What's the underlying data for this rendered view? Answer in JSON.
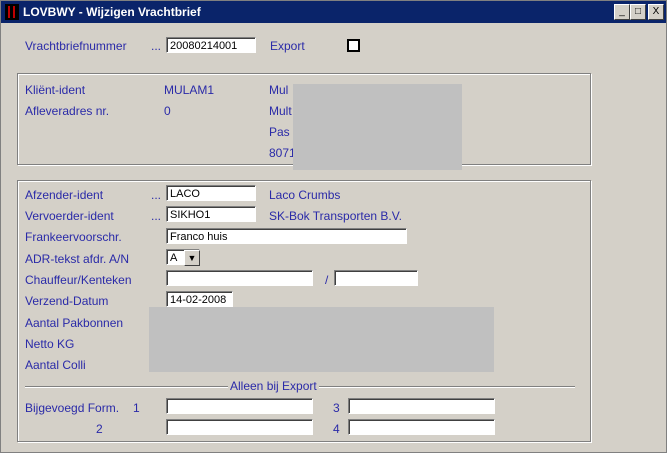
{
  "window": {
    "title": "LOVBWY - Wijzigen Vrachtbrief"
  },
  "titlebar_buttons": {
    "minimize": "_",
    "maximize": "□",
    "close": "X"
  },
  "header": {
    "vrachtbrief_label": "Vrachtbriefnummer",
    "vrachtbrief_dots": "...",
    "vrachtbrief_value": "20080214001",
    "export_label": "Export"
  },
  "client": {
    "ident_label": "Kliënt-ident",
    "ident_value": "MULAM1",
    "afleveradres_label": "Afleveradres nr.",
    "afleveradres_value": "0",
    "name_partial": "Mul",
    "addr1_partial": "Mult",
    "addr2_partial": "Pas",
    "addr3_partial": "8071"
  },
  "shipment": {
    "afzender_label": "Afzender-ident",
    "afzender_dots": "...",
    "afzender_value": "LACO",
    "afzender_name": "Laco Crumbs",
    "vervoerder_label": "Vervoerder-ident",
    "vervoerder_dots": "...",
    "vervoerder_value": "SIKHO1",
    "vervoerder_name": "SK-Bok Transporten B.V.",
    "frankeer_label": "Frankeervoorschr.",
    "frankeer_value": "Franco huis",
    "adr_label": "ADR-tekst afdr. A/N",
    "adr_value": "A",
    "chauffeur_label": "Chauffeur/Kenteken",
    "chauffeur_slash": "/",
    "chauffeur_value": "",
    "kenteken_value": "",
    "verzend_label": "Verzend-Datum",
    "verzend_value": "14-02-2008",
    "pakbonnen_label": "Aantal Pakbonnen",
    "netto_label": "Netto KG",
    "colli_label": "Aantal Colli"
  },
  "export_section": {
    "heading": "Alleen bij Export",
    "form_label": "Bijgevoegd Form.",
    "n1": "1",
    "n2": "2",
    "n3": "3",
    "n4": "4",
    "form1": "",
    "form2": "",
    "form3": "",
    "form4": ""
  }
}
